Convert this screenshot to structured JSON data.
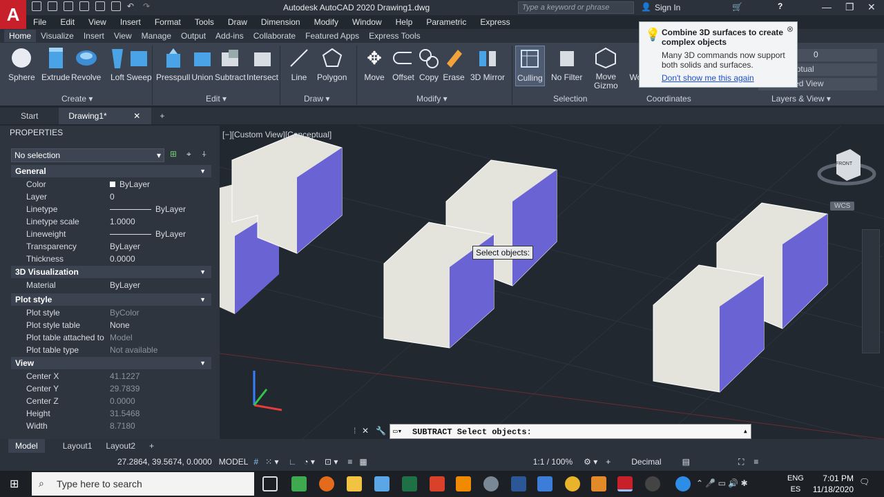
{
  "titlebar": {
    "logo": "A",
    "title": "Autodesk AutoCAD 2020   Drawing1.dwg",
    "search_placeholder": "Type a keyword or phrase",
    "signin": "Sign In"
  },
  "menu": [
    "File",
    "Edit",
    "View",
    "Insert",
    "Format",
    "Tools",
    "Draw",
    "Dimension",
    "Modify",
    "Window",
    "Help",
    "Parametric",
    "Express"
  ],
  "ribbon_tabs": [
    "Home",
    "Visualize",
    "Insert",
    "View",
    "Manage",
    "Output",
    "Add-ins",
    "Collaborate",
    "Featured Apps",
    "Express Tools"
  ],
  "tools": {
    "sphere": "Sphere",
    "extrude": "Extrude",
    "revolve": "Revolve",
    "loft": "Loft",
    "sweep": "Sweep",
    "presspull": "Presspull",
    "union": "Union",
    "subtract": "Subtract",
    "intersect": "Intersect",
    "line": "Line",
    "polygon": "Polygon",
    "move": "Move",
    "offset": "Offset",
    "copy": "Copy",
    "erase": "Erase",
    "mirror3d": "3D Mirror",
    "culling": "Culling",
    "nofilter": "No Filter",
    "movegizmo": "Move\nGizmo",
    "world": "World"
  },
  "panels": {
    "create": "Create",
    "edit": "Edit",
    "draw": "Draw",
    "modify": "Modify",
    "selection": "Selection",
    "coordinates": "Coordinates",
    "layers": "Layers & View"
  },
  "layers_ctrl": {
    "layer_value": "0",
    "visual_style": "Conceptual",
    "view": "Unsaved View"
  },
  "tooltip": {
    "title": "Combine 3D surfaces to create complex objects",
    "body": "Many 3D commands now support both solids and surfaces.",
    "link": "Don't show me this again"
  },
  "file_tabs": {
    "start": "Start",
    "drawing": "Drawing1*"
  },
  "properties": {
    "header": "PROPERTIES",
    "selection": "No selection",
    "sections": {
      "general": "General",
      "vis3d": "3D Visualization",
      "plot": "Plot style",
      "view": "View"
    },
    "general": [
      {
        "k": "Color",
        "v": "ByLayer"
      },
      {
        "k": "Layer",
        "v": "0"
      },
      {
        "k": "Linetype",
        "v": "ByLayer"
      },
      {
        "k": "Linetype scale",
        "v": "1.0000"
      },
      {
        "k": "Lineweight",
        "v": "ByLayer"
      },
      {
        "k": "Transparency",
        "v": "ByLayer"
      },
      {
        "k": "Thickness",
        "v": "0.0000"
      }
    ],
    "vis3d": [
      {
        "k": "Material",
        "v": "ByLayer"
      }
    ],
    "plot": [
      {
        "k": "Plot style",
        "v": "ByColor"
      },
      {
        "k": "Plot style table",
        "v": "None"
      },
      {
        "k": "Plot table attached to",
        "v": "Model"
      },
      {
        "k": "Plot table type",
        "v": "Not available"
      }
    ],
    "view": [
      {
        "k": "Center X",
        "v": "41.1227"
      },
      {
        "k": "Center Y",
        "v": "29.7839"
      },
      {
        "k": "Center Z",
        "v": "0.0000"
      },
      {
        "k": "Height",
        "v": "31.5468"
      },
      {
        "k": "Width",
        "v": "8.7180"
      }
    ]
  },
  "viewport": {
    "label": "[−][Custom View][Conceptual]",
    "select_tip": "Select objects:",
    "wcs": "WCS",
    "viewcube_face": "FRONT"
  },
  "command": {
    "text": "SUBTRACT Select objects:"
  },
  "layout_tabs": [
    "Model",
    "Layout1",
    "Layout2"
  ],
  "status": {
    "coords": "27.2864, 39.5674, 0.0000",
    "model": "MODEL",
    "scale": "1:1 / 100%",
    "units": "Decimal"
  },
  "taskbar": {
    "search": "Type here to search",
    "lang1": "ENG",
    "lang2": "ES",
    "time": "7:01 PM",
    "date": "11/18/2020"
  },
  "colors": {
    "accent": "#1f6fd6",
    "face_blue": "#6a63d4",
    "face_light": "#e4e3dc",
    "background": "#212830"
  }
}
